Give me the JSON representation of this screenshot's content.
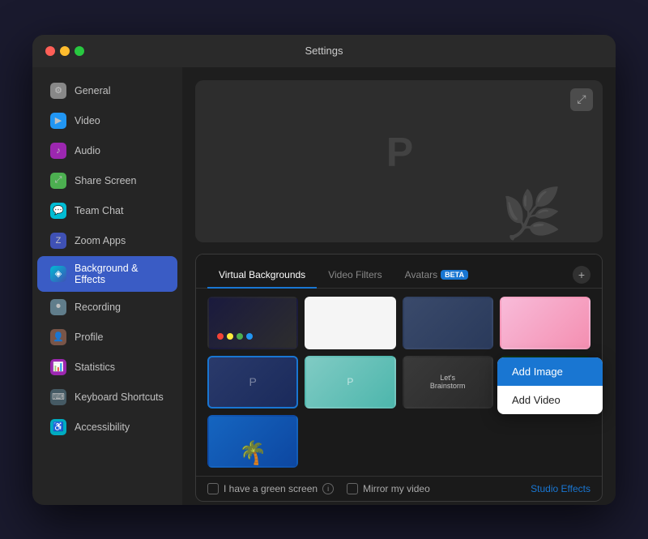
{
  "window": {
    "title": "Settings"
  },
  "sidebar": {
    "items": [
      {
        "id": "general",
        "label": "General",
        "icon": "⚙",
        "iconClass": "icon-general",
        "active": false
      },
      {
        "id": "video",
        "label": "Video",
        "icon": "▶",
        "iconClass": "icon-video",
        "active": false
      },
      {
        "id": "audio",
        "label": "Audio",
        "icon": "♪",
        "iconClass": "icon-audio",
        "active": false
      },
      {
        "id": "share-screen",
        "label": "Share Screen",
        "icon": "⤢",
        "iconClass": "icon-share",
        "active": false
      },
      {
        "id": "team-chat",
        "label": "Team Chat",
        "icon": "💬",
        "iconClass": "icon-team",
        "active": false
      },
      {
        "id": "zoom-apps",
        "label": "Zoom Apps",
        "icon": "Z",
        "iconClass": "icon-zoom",
        "active": false
      },
      {
        "id": "background-effects",
        "label": "Background & Effects",
        "icon": "◈",
        "iconClass": "icon-bg",
        "active": true
      },
      {
        "id": "recording",
        "label": "Recording",
        "icon": "⏺",
        "iconClass": "icon-recording",
        "active": false
      },
      {
        "id": "profile",
        "label": "Profile",
        "icon": "👤",
        "iconClass": "icon-profile",
        "active": false
      },
      {
        "id": "statistics",
        "label": "Statistics",
        "icon": "📊",
        "iconClass": "icon-stats",
        "active": false
      },
      {
        "id": "keyboard-shortcuts",
        "label": "Keyboard Shortcuts",
        "icon": "⌨",
        "iconClass": "icon-keyboard",
        "active": false
      },
      {
        "id": "accessibility",
        "label": "Accessibility",
        "icon": "♿",
        "iconClass": "icon-accessibility",
        "active": false
      }
    ]
  },
  "main": {
    "tabs": [
      {
        "id": "virtual-backgrounds",
        "label": "Virtual Backgrounds",
        "active": true,
        "beta": false
      },
      {
        "id": "video-filters",
        "label": "Video Filters",
        "active": false,
        "beta": false
      },
      {
        "id": "avatars",
        "label": "Avatars",
        "active": false,
        "beta": true
      }
    ],
    "add_button_label": "+",
    "backgrounds": [
      {
        "id": "bg1",
        "style": "thumb-colorful",
        "selected": false
      },
      {
        "id": "bg2",
        "style": "thumb-white",
        "selected": false
      },
      {
        "id": "bg3",
        "style": "thumb-room",
        "selected": false
      },
      {
        "id": "bg4",
        "style": "thumb-pink",
        "selected": false
      },
      {
        "id": "bg5",
        "style": "thumb-selected",
        "selected": true
      },
      {
        "id": "bg6",
        "style": "thumb-teal",
        "selected": false
      },
      {
        "id": "bg7",
        "style": "thumb-text",
        "selected": false
      },
      {
        "id": "bg8",
        "style": "thumb-aurora",
        "selected": false
      },
      {
        "id": "bg9",
        "style": "thumb-beach",
        "selected": false
      }
    ],
    "footer": {
      "green_screen_label": "I have a green screen",
      "mirror_label": "Mirror my video",
      "studio_effects_label": "Studio Effects"
    }
  },
  "dropdown": {
    "items": [
      {
        "id": "add-image",
        "label": "Add Image",
        "highlighted": true
      },
      {
        "id": "add-video",
        "label": "Add Video",
        "highlighted": false
      }
    ]
  }
}
